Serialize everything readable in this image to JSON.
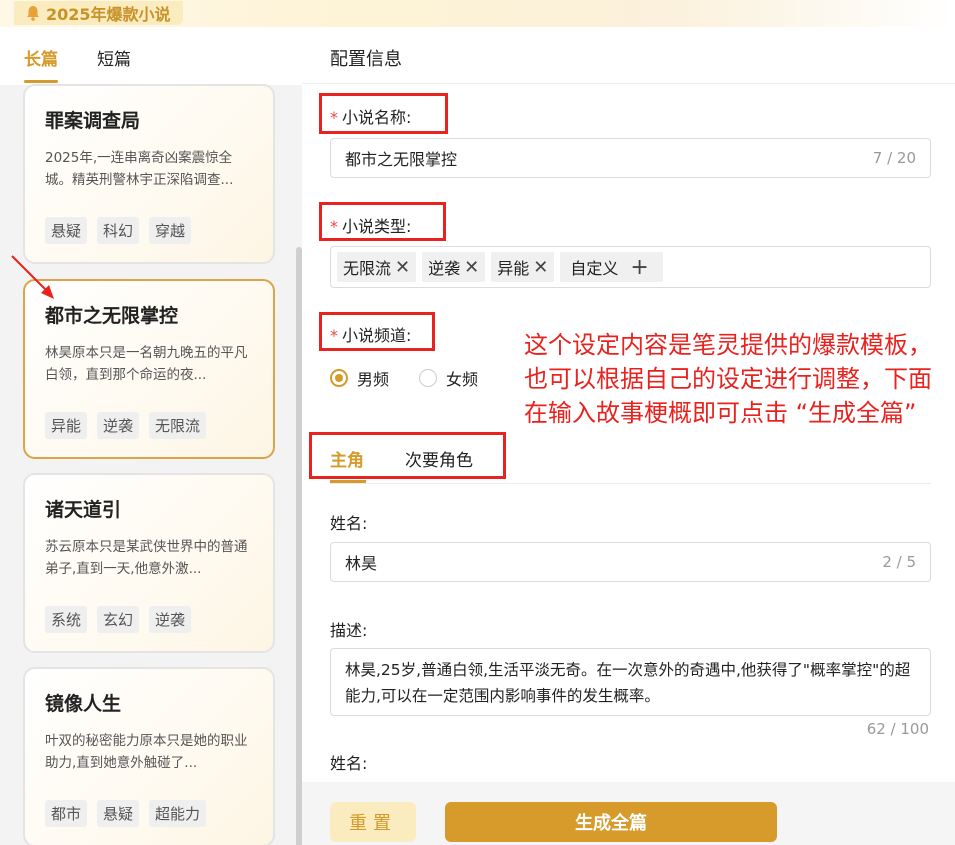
{
  "app": {
    "title": "2025年爆款小说"
  },
  "left_tabs": [
    {
      "label": "长篇"
    },
    {
      "label": "短篇"
    }
  ],
  "cards": [
    {
      "title": "罪案调查局",
      "desc": "2025年,一连串离奇凶案震惊全城。精英刑警林宇正深陷调查...",
      "tags": [
        "悬疑",
        "科幻",
        "穿越"
      ]
    },
    {
      "title": "都市之无限掌控",
      "desc": "林昊原本只是一名朝九晚五的平凡白领，直到那个命运的夜...",
      "tags": [
        "异能",
        "逆袭",
        "无限流"
      ]
    },
    {
      "title": "诸天道引",
      "desc": "苏云原本只是某武侠世界中的普通弟子,直到一天,他意外激...",
      "tags": [
        "系统",
        "玄幻",
        "逆袭"
      ]
    },
    {
      "title": "镜像人生",
      "desc": "叶双的秘密能力原本只是她的职业助力,直到她意外触碰了...",
      "tags": [
        "都市",
        "悬疑",
        "超能力"
      ]
    }
  ],
  "config": {
    "title": "配置信息",
    "name_label": "小说名称:",
    "name_value": "都市之无限掌控",
    "name_count": "7 / 20",
    "type_label": "小说类型:",
    "type_tags": [
      "无限流",
      "逆袭",
      "异能"
    ],
    "custom_label": "自定义",
    "channel_label": "小说频道:",
    "channel_options": [
      "男频",
      "女频"
    ],
    "channel_selected": "男频"
  },
  "annotation": "这个设定内容是笔灵提供的爆款模板，也可以根据自己的设定进行调整，下面在输入故事梗概即可点击 “生成全篇”",
  "role_tabs": [
    {
      "label": "主角"
    },
    {
      "label": "次要角色"
    }
  ],
  "protagonist": {
    "name_label": "姓名:",
    "name_value": "林昊",
    "name_count": "2 / 5",
    "desc_label": "描述:",
    "desc_value": "林昊,25岁,普通白领,生活平淡无奇。在一次意外的奇遇中,他获得了\"概率掌控\"的超能力,可以在一定范围内影响事件的发生概率。",
    "desc_count": "62 / 100",
    "next_name_label": "姓名:"
  },
  "footer": {
    "reset_label": "重置",
    "generate_label": "生成全篇"
  },
  "colors": {
    "accent": "#d49a2a",
    "annotation_red": "#e8231f",
    "card_selected_border": "#dca44a"
  }
}
